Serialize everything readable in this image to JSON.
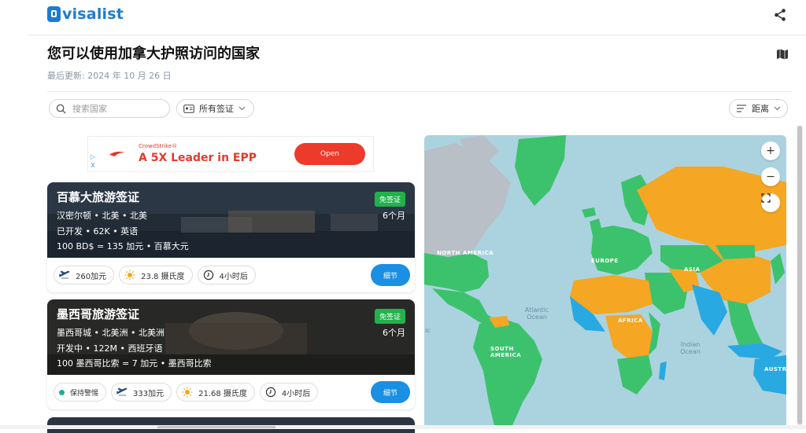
{
  "header": {
    "logo_text": "visalist",
    "share_icon": "share-icon"
  },
  "page": {
    "title": "您可以使用加拿大护照访问的国家",
    "updated": "最后更新: 2024 年 10 月 26 日",
    "map_icon": "map-icon"
  },
  "filters": {
    "search_placeholder": "搜索国家",
    "visa_filter_label": "所有签证",
    "sort_label": "距离"
  },
  "ad": {
    "brand": "CrowdStrike®",
    "headline": "A 5X Leader in EPP",
    "button": "Open",
    "badge": "▷ X"
  },
  "cards": [
    {
      "title": "百慕大旅游签证",
      "badge": "免签证",
      "location": "汉密尔顿 • 北美 • 北美",
      "stats": "已开发 • 62K • 英语",
      "currency": "100 BD$ = 135 加元 • 百慕大元",
      "duration": "6个月",
      "chips": {
        "flight": "260加元",
        "temp": "23.8 摄氏度",
        "time": "4小时后"
      },
      "details": "细节"
    },
    {
      "title": "墨西哥旅游签证",
      "badge": "免签证",
      "location": "墨西哥城 • 北美洲 • 北美洲",
      "stats": "开发中 • 122M • 西班牙语",
      "currency": "100 墨西哥比索 = 7 加元 • 墨西哥比索",
      "duration": "6个月",
      "chips": {
        "advisory": "保持警惕",
        "flight": "333加元",
        "temp": "21.68 摄氏度",
        "time": "4小时后"
      },
      "details": "细节"
    }
  ],
  "map": {
    "zoom_in": "+",
    "zoom_out": "−",
    "labels": {
      "north_america": "NORTH AMERICA",
      "europe": "EUROPE",
      "asia": "ASIA",
      "africa": "AFRICA",
      "south_america": "SOUTH AMERICA",
      "australia": "AUSTR",
      "atlantic": "Atlantic Ocean",
      "indian": "Indian Ocean",
      "pacific": "ic"
    },
    "colors": {
      "visa_free": "#3cc26c",
      "visa_required": "#f5a623",
      "eta": "#29a9e1",
      "ocean": "#aad3df",
      "no_data": "#b8bfc6"
    }
  }
}
